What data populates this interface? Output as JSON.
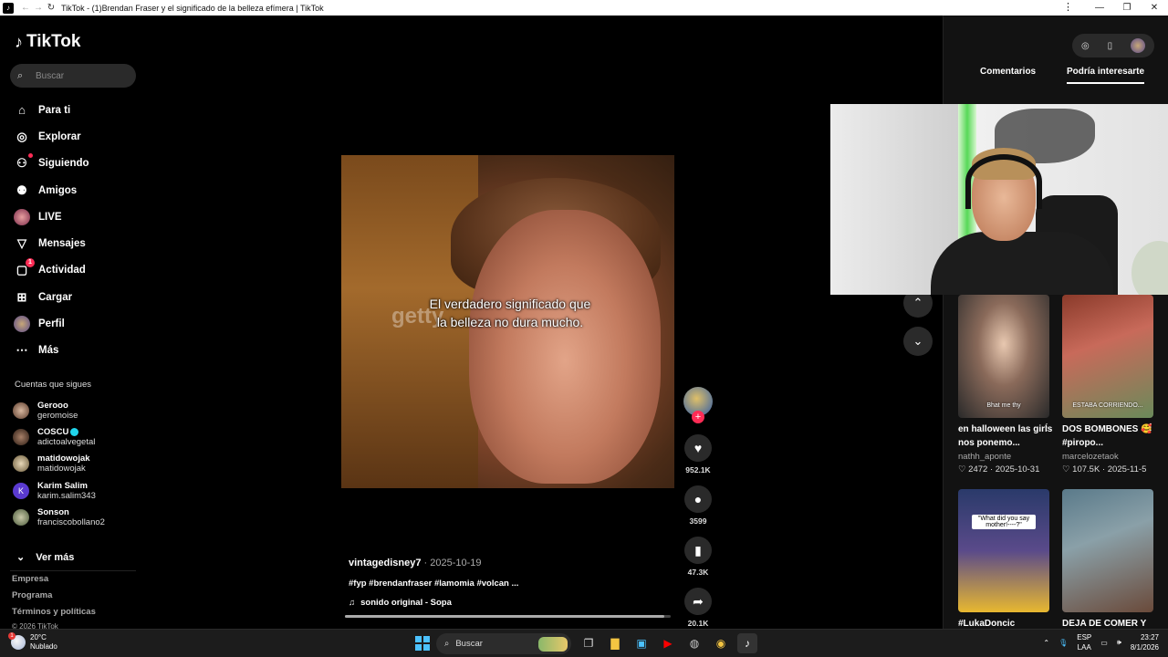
{
  "window": {
    "title": "TikTok - (1)Brendan Fraser y el significado de la belleza efímera | TikTok",
    "menu_icon": "⋮",
    "minimize": "—",
    "restore": "❐",
    "close": "✕"
  },
  "sidebar": {
    "logo": "TikTok",
    "search_placeholder": "Buscar",
    "nav": [
      {
        "label": "Para ti",
        "icon": "home-icon"
      },
      {
        "label": "Explorar",
        "icon": "compass-icon"
      },
      {
        "label": "Siguiendo",
        "icon": "following-icon"
      },
      {
        "label": "Amigos",
        "icon": "friends-icon"
      },
      {
        "label": "LIVE",
        "icon": "live-icon"
      },
      {
        "label": "Mensajes",
        "icon": "messages-icon"
      },
      {
        "label": "Actividad",
        "icon": "activity-icon",
        "badge": "1"
      },
      {
        "label": "Cargar",
        "icon": "upload-icon"
      },
      {
        "label": "Perfil",
        "icon": "profile-icon"
      },
      {
        "label": "Más",
        "icon": "more-icon"
      }
    ],
    "following_title": "Cuentas que sigues",
    "following": [
      {
        "name": "Gerooo",
        "handle": "geromoise"
      },
      {
        "name": "COSCU",
        "handle": "adictoalvegetal"
      },
      {
        "name": "matidowojak",
        "handle": "matidowojak"
      },
      {
        "name": "Karim Salim",
        "handle": "karim.salim343",
        "initial": "K"
      },
      {
        "name": "Sonson",
        "handle": "franciscobollano2"
      }
    ],
    "ver_mas": "Ver más",
    "footer": [
      "Empresa",
      "Programa",
      "Términos y políticas",
      "© 2026 TikTok"
    ]
  },
  "video": {
    "caption": "El verdadero significado que la belleza no dura mucho.",
    "watermark": "getty",
    "username": "vintagedisney7",
    "date": "· 2025-10-19",
    "description": "#fyp #brendanfraser #lamomia #volcan ...",
    "music": "sonido original - Sopa",
    "progress": 0.98
  },
  "actions": {
    "likes": "952.1K",
    "comments": "3599",
    "saves": "47.3K",
    "shares": "20.1K"
  },
  "right_panel": {
    "tabs": [
      "Comentarios",
      "Podría interesarte"
    ],
    "cards": [
      {
        "title": "en halloween las girls nos ponemo...",
        "author": "nathh_aponte",
        "likes": "2472",
        "date": "2025-10-31",
        "thumb_text": "Bhat me thy"
      },
      {
        "title": "DOS BOMBONES 🥰 #piropo...",
        "author": "marcelozetaok",
        "likes": "107.5K",
        "date": "2025-11-5",
        "thumb_text": "ESTABA CORRIENDO..."
      },
      {
        "title": "#LukaDoncic",
        "author": "",
        "likes": "",
        "date": "",
        "thumb_text": "\"What did you say mother!----?\""
      },
      {
        "title": "DEJA DE COMER Y",
        "author": "",
        "likes": "",
        "date": "",
        "thumb_text": ""
      }
    ]
  },
  "taskbar": {
    "temp": "20°C",
    "weather": "Nublado",
    "weather_badge": "1",
    "search": "Buscar",
    "lang1": "ESP",
    "lang2": "LAA",
    "time": "23:27",
    "date": "8/1/2026"
  }
}
